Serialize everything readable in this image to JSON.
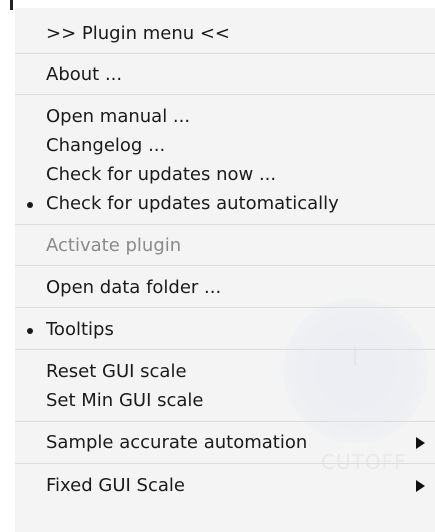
{
  "menu": {
    "header": ">> Plugin menu <<",
    "about": "About ...",
    "open_manual": "Open manual ...",
    "changelog": "Changelog ...",
    "check_updates_now": "Check for updates now ...",
    "check_updates_auto": "Check for updates automatically",
    "activate_plugin": "Activate plugin",
    "open_data_folder": "Open data folder ...",
    "tooltips": "Tooltips",
    "reset_gui_scale": "Reset GUI scale",
    "set_min_gui_scale": "Set Min GUI scale",
    "sample_accurate_automation": "Sample accurate automation",
    "fixed_gui_scale": "Fixed GUI Scale"
  },
  "state": {
    "check_updates_auto_checked": true,
    "tooltips_checked": true,
    "activate_plugin_enabled": false
  },
  "background": {
    "faint_text": "CUTOFF"
  },
  "icons": {
    "checked": "bullet-icon",
    "submenu": "submenu-arrow-icon"
  },
  "colors": {
    "menu_bg": "#f4f4f4",
    "text": "#1a1a1a",
    "disabled_text": "#8a8a8a",
    "separator": "#dcdcdc"
  }
}
